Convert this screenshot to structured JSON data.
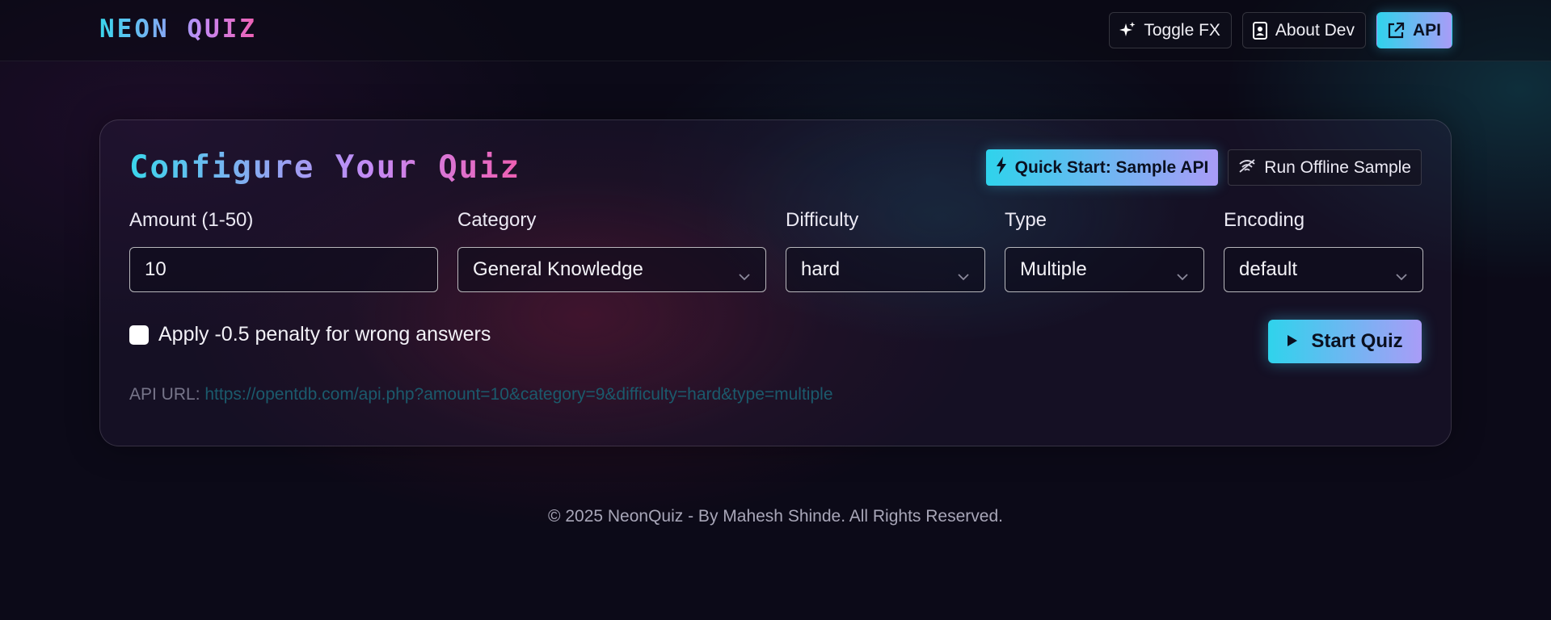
{
  "header": {
    "brand": "NEON QUIZ",
    "nav": [
      {
        "label": "Toggle FX",
        "icon": "sparkles-icon"
      },
      {
        "label": "About Dev",
        "icon": "id-badge-icon"
      },
      {
        "label": "API",
        "icon": "external-link-icon"
      }
    ]
  },
  "config": {
    "title": "Configure Your Quiz",
    "quick_start_label": "Quick Start: Sample API",
    "offline_label": "Run Offline Sample",
    "fields": {
      "amount": {
        "label": "Amount (1-50)",
        "value": "10"
      },
      "category": {
        "label": "Category",
        "value": "General Knowledge"
      },
      "difficulty": {
        "label": "Difficulty",
        "value": "hard"
      },
      "type": {
        "label": "Type",
        "value": "Multiple"
      },
      "encoding": {
        "label": "Encoding",
        "value": "default"
      }
    },
    "penalty": {
      "label": "Apply -0.5 penalty for wrong answers",
      "checked": false
    },
    "start_label": "Start Quiz",
    "api_url": {
      "label": "API URL:",
      "value": "https://opentdb.com/api.php?amount=10&category=9&difficulty=hard&type=multiple"
    }
  },
  "footer": {
    "text": "© 2025 NeonQuiz - By Mahesh Shinde. All Rights Reserved."
  },
  "colors": {
    "accent_cyan": "#2fd3ec",
    "accent_purple": "#a99cf7",
    "accent_pink": "#ef5fb2",
    "background": "#0c0a18"
  }
}
